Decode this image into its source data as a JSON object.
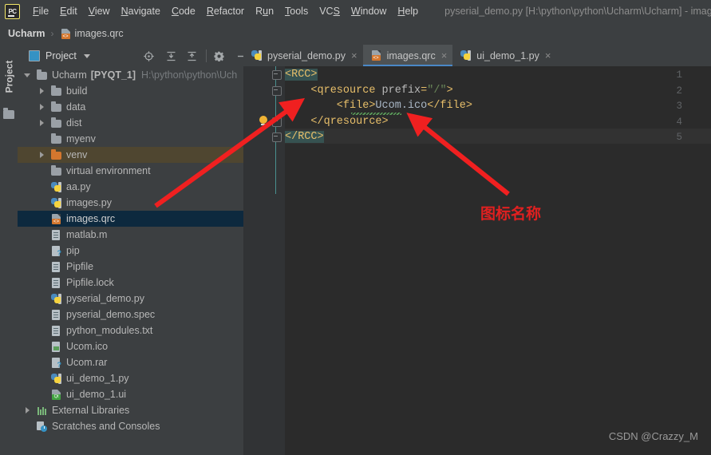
{
  "window": {
    "title": "pyserial_demo.py [H:\\python\\python\\Ucharm\\Ucharm] - imag",
    "logo": "PC"
  },
  "menubar": {
    "items": [
      {
        "label": "File",
        "mnemonic": "F"
      },
      {
        "label": "Edit",
        "mnemonic": "E"
      },
      {
        "label": "View",
        "mnemonic": "V"
      },
      {
        "label": "Navigate",
        "mnemonic": "N"
      },
      {
        "label": "Code",
        "mnemonic": "C"
      },
      {
        "label": "Refactor",
        "mnemonic": "R"
      },
      {
        "label": "Run",
        "mnemonic": "u"
      },
      {
        "label": "Tools",
        "mnemonic": "T"
      },
      {
        "label": "VCS",
        "mnemonic": "S"
      },
      {
        "label": "Window",
        "mnemonic": "W"
      },
      {
        "label": "Help",
        "mnemonic": "H"
      }
    ]
  },
  "breadcrumb": {
    "root": "Ucharm",
    "separator": "›",
    "file": "images.qrc"
  },
  "toolstrip": {
    "project_label": "Project"
  },
  "project_panel": {
    "title": "Project",
    "tools": [
      {
        "name": "locate-icon"
      },
      {
        "name": "expand-all-icon"
      },
      {
        "name": "collapse-all-icon"
      },
      {
        "name": "gear-icon"
      },
      {
        "name": "minimize-icon"
      }
    ],
    "tree": [
      {
        "label": "Ucharm",
        "suffix": "[PYQT_1]",
        "path": "H:\\python\\python\\Uch",
        "icon": "folder",
        "arrow": "down",
        "indent": 0,
        "state": "normal"
      },
      {
        "label": "build",
        "icon": "folder",
        "arrow": "right",
        "indent": 1,
        "state": "normal"
      },
      {
        "label": "data",
        "icon": "folder",
        "arrow": "right",
        "indent": 1,
        "state": "normal"
      },
      {
        "label": "dist",
        "icon": "folder",
        "arrow": "right",
        "indent": 1,
        "state": "normal"
      },
      {
        "label": "myenv",
        "icon": "folder",
        "arrow": "none",
        "indent": 1,
        "state": "normal"
      },
      {
        "label": "venv",
        "icon": "folder-orange",
        "arrow": "right",
        "indent": 1,
        "state": "highlight"
      },
      {
        "label": "virtual environment",
        "icon": "folder",
        "arrow": "none",
        "indent": 1,
        "state": "normal"
      },
      {
        "label": "aa.py",
        "icon": "python",
        "arrow": "none",
        "indent": 1,
        "state": "normal"
      },
      {
        "label": "images.py",
        "icon": "python",
        "arrow": "none",
        "indent": 1,
        "state": "normal"
      },
      {
        "label": "images.qrc",
        "icon": "qrc",
        "arrow": "none",
        "indent": 1,
        "state": "selected"
      },
      {
        "label": "matlab.m",
        "icon": "doc",
        "arrow": "none",
        "indent": 1,
        "state": "normal"
      },
      {
        "label": "pip",
        "icon": "unknown",
        "arrow": "none",
        "indent": 1,
        "state": "normal"
      },
      {
        "label": "Pipfile",
        "icon": "doc",
        "arrow": "none",
        "indent": 1,
        "state": "normal"
      },
      {
        "label": "Pipfile.lock",
        "icon": "doc",
        "arrow": "none",
        "indent": 1,
        "state": "normal"
      },
      {
        "label": "pyserial_demo.py",
        "icon": "python",
        "arrow": "none",
        "indent": 1,
        "state": "normal"
      },
      {
        "label": "pyserial_demo.spec",
        "icon": "doc",
        "arrow": "none",
        "indent": 1,
        "state": "normal"
      },
      {
        "label": "python_modules.txt",
        "icon": "doc",
        "arrow": "none",
        "indent": 1,
        "state": "normal"
      },
      {
        "label": "Ucom.ico",
        "icon": "image",
        "arrow": "none",
        "indent": 1,
        "state": "normal"
      },
      {
        "label": "Ucom.rar",
        "icon": "unknown",
        "arrow": "none",
        "indent": 1,
        "state": "normal"
      },
      {
        "label": "ui_demo_1.py",
        "icon": "python",
        "arrow": "none",
        "indent": 1,
        "state": "normal"
      },
      {
        "label": "ui_demo_1.ui",
        "icon": "qtui",
        "arrow": "none",
        "indent": 1,
        "state": "normal"
      },
      {
        "label": "External Libraries",
        "icon": "library",
        "arrow": "right",
        "indent": 0,
        "state": "normal"
      },
      {
        "label": "Scratches and Consoles",
        "icon": "scratches",
        "arrow": "none",
        "indent": 0,
        "state": "normal"
      }
    ]
  },
  "editor": {
    "tabs": [
      {
        "label": "pyserial_demo.py",
        "icon": "python",
        "active": false,
        "close": "×"
      },
      {
        "label": "images.qrc",
        "icon": "qrc",
        "active": true,
        "close": "×"
      },
      {
        "label": "ui_demo_1.py",
        "icon": "python",
        "active": false,
        "close": "×"
      }
    ],
    "line_numbers": [
      "1",
      "2",
      "3",
      "4",
      "5"
    ],
    "code": [
      {
        "line": 1,
        "indent": 0,
        "tokens": [
          {
            "t": "<RCC>",
            "c": "tag",
            "match": true
          }
        ]
      },
      {
        "line": 2,
        "indent": 0,
        "tokens": [
          {
            "t": "    <qresource ",
            "c": "tag"
          },
          {
            "t": "prefix",
            "c": "attr"
          },
          {
            "t": "=",
            "c": "tag"
          },
          {
            "t": "\"/\"",
            "c": "val"
          },
          {
            "t": ">",
            "c": "tag"
          }
        ]
      },
      {
        "line": 3,
        "indent": 0,
        "tokens": [
          {
            "t": "        <file>",
            "c": "tag"
          },
          {
            "t": "Ucom.ico",
            "c": "txt"
          },
          {
            "t": "</file>",
            "c": "tag"
          }
        ]
      },
      {
        "line": 4,
        "indent": 0,
        "tokens": [
          {
            "t": "    </qresource>",
            "c": "tag"
          }
        ]
      },
      {
        "line": 5,
        "indent": 0,
        "tokens": [
          {
            "t": "</RCC>",
            "c": "tag",
            "match": true
          }
        ]
      }
    ],
    "intention_bulb": "lightbulb-icon",
    "warning_underline": "Ucom.ico"
  },
  "annotations": {
    "note_text": "图标名称",
    "note_color": "#e02020",
    "arrow_color": "#f02020",
    "watermark": "CSDN @Crazzy_M"
  }
}
